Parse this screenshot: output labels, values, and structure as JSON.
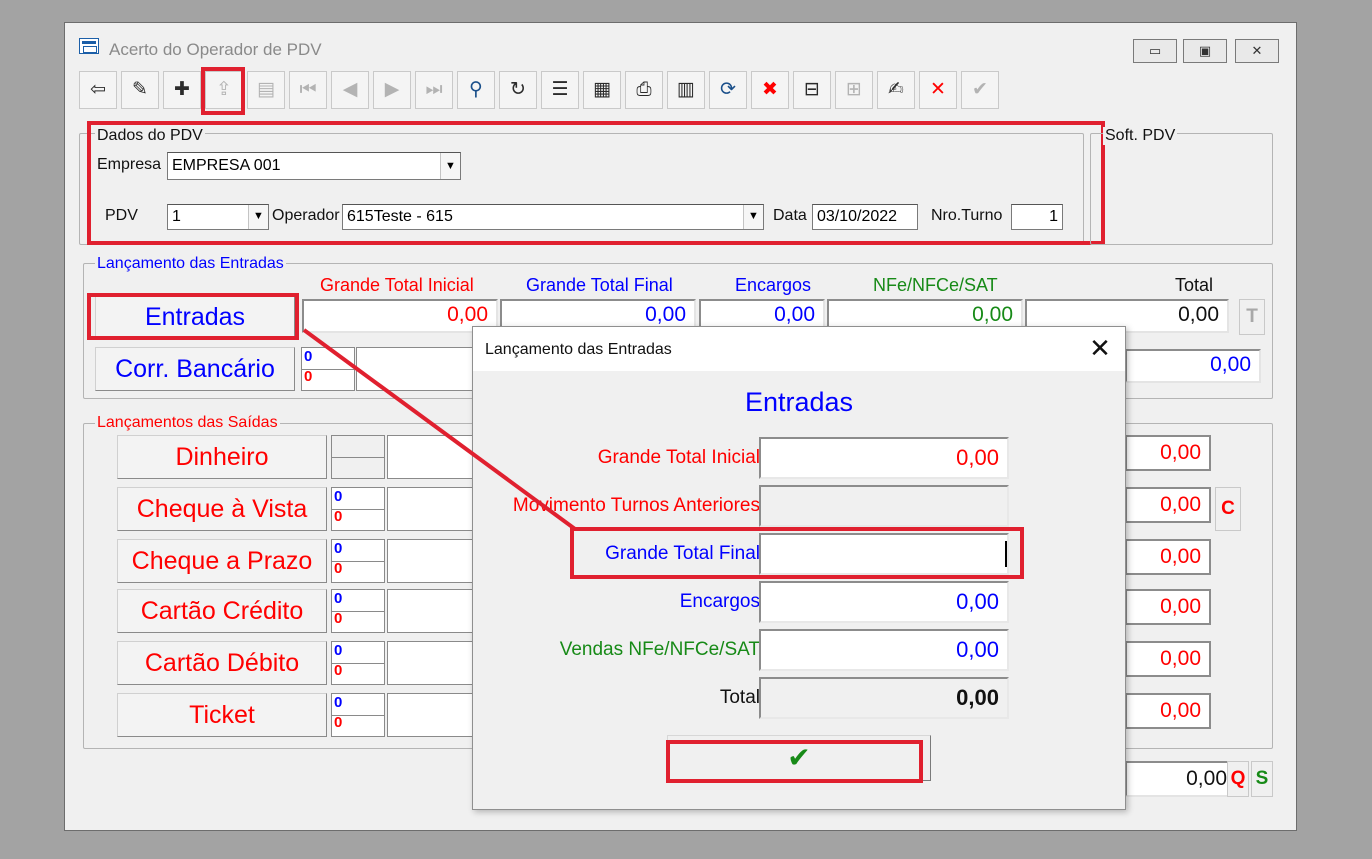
{
  "window": {
    "title": "Acerto do Operador de PDV",
    "controls": {
      "minimize": "▭",
      "maximize": "▣",
      "close": "✕"
    }
  },
  "toolbar": [
    {
      "name": "exit",
      "glyph": "⇦",
      "enabled": true
    },
    {
      "name": "eraser",
      "glyph": "✎",
      "enabled": true
    },
    {
      "name": "add-record",
      "glyph": "✚",
      "enabled": true
    },
    {
      "name": "import",
      "glyph": "⇪",
      "enabled": false
    },
    {
      "name": "print",
      "glyph": "▤",
      "enabled": false
    },
    {
      "name": "first",
      "glyph": "⏮",
      "enabled": false
    },
    {
      "name": "previous",
      "glyph": "◀",
      "enabled": false
    },
    {
      "name": "next",
      "glyph": "▶",
      "enabled": false
    },
    {
      "name": "last",
      "glyph": "⏭",
      "enabled": false
    },
    {
      "name": "search",
      "glyph": "⚲",
      "enabled": true
    },
    {
      "name": "refresh",
      "glyph": "↻",
      "enabled": true
    },
    {
      "name": "list",
      "glyph": "☰",
      "enabled": true
    },
    {
      "name": "grid",
      "glyph": "▦",
      "enabled": true
    },
    {
      "name": "preview",
      "glyph": "⎙",
      "enabled": true
    },
    {
      "name": "calculator",
      "glyph": "▥",
      "enabled": true
    },
    {
      "name": "sync",
      "glyph": "⟳",
      "enabled": true
    },
    {
      "name": "delete-record",
      "glyph": "✖",
      "enabled": true
    },
    {
      "name": "remove-item",
      "glyph": "⊟",
      "enabled": true
    },
    {
      "name": "table",
      "glyph": "⊞",
      "enabled": false
    },
    {
      "name": "edit",
      "glyph": "✍",
      "enabled": true
    },
    {
      "name": "cancel",
      "glyph": "✕",
      "enabled": true
    },
    {
      "name": "confirm",
      "glyph": "✔",
      "enabled": false
    }
  ],
  "colors": {
    "red": "#ff0000",
    "blue": "#0000ff",
    "green": "#178a17",
    "highlight": "#e0202f"
  },
  "dados_pdv": {
    "title": "Dados do PDV",
    "empresa_label": "Empresa",
    "empresa_value": "EMPRESA 001",
    "pdv_label": "PDV",
    "pdv_value": "1",
    "operador_label": "Operador",
    "operador_value": "615Teste - 615",
    "data_label": "Data",
    "data_value": "03/10/2022",
    "turno_label": "Nro.Turno",
    "turno_value": "1"
  },
  "soft_pdv": {
    "title": "Soft. PDV"
  },
  "entradas_group": {
    "title": "Lançamento das Entradas",
    "headers": {
      "gt_inicial": "Grande Total Inicial",
      "gt_final": "Grande Total Final",
      "encargos": "Encargos",
      "nfe": "NFe/NFCe/SAT",
      "total": "Total"
    },
    "entradas_label": "Entradas",
    "values": {
      "gt_inicial": "0,00",
      "gt_final": "0,00",
      "encargos": "0,00",
      "nfe": "0,00",
      "total": "0,00"
    },
    "t_label": "T",
    "corr_label": "Corr. Bancário",
    "corr_mini": [
      "0",
      "0"
    ],
    "corr_total": "0,00"
  },
  "saidas_group": {
    "title": "Lançamentos das Saídas",
    "rows": [
      {
        "label": "Dinheiro",
        "mini": [
          "",
          ""
        ],
        "total": "0,00"
      },
      {
        "label": "Cheque à Vista",
        "mini": [
          "0",
          "0"
        ],
        "total": "0,00"
      },
      {
        "label": "Cheque a Prazo",
        "mini": [
          "0",
          "0"
        ],
        "total": "0,00"
      },
      {
        "label": "Cartão Crédito",
        "mini": [
          "0",
          "0"
        ],
        "total": "0,00"
      },
      {
        "label": "Cartão Débito",
        "mini": [
          "0",
          "0"
        ],
        "total": "0,00"
      },
      {
        "label": "Ticket",
        "mini": [
          "0",
          "0"
        ],
        "total": "0,00"
      }
    ],
    "c_label": "C"
  },
  "footer": {
    "total": "0,00",
    "q_label": "Q",
    "s_label": "S"
  },
  "dialog": {
    "title": "Lançamento das Entradas",
    "close": "✕",
    "heading": "Entradas",
    "fields": [
      {
        "label": "Grande Total Inicial",
        "value": "0,00",
        "label_color": "#ff0000",
        "value_color": "#ff0000",
        "readonly": false
      },
      {
        "label": "Movimento Turnos Anteriores",
        "value": "",
        "label_color": "#ff0000",
        "value_color": "#000000",
        "readonly": true
      },
      {
        "label": "Grande Total Final",
        "value": "",
        "label_color": "#0000ff",
        "value_color": "#000000",
        "readonly": false
      },
      {
        "label": "Encargos",
        "value": "0,00",
        "label_color": "#0000ff",
        "value_color": "#0000ff",
        "readonly": false
      },
      {
        "label": "Vendas NFe/NFCe/SAT",
        "value": "0,00",
        "label_color": "#178a17",
        "value_color": "#0000ff",
        "readonly": false
      },
      {
        "label": "Total",
        "value": "0,00",
        "label_color": "#111111",
        "value_color": "#111111",
        "readonly": true
      }
    ],
    "ok_glyph": "✔"
  }
}
